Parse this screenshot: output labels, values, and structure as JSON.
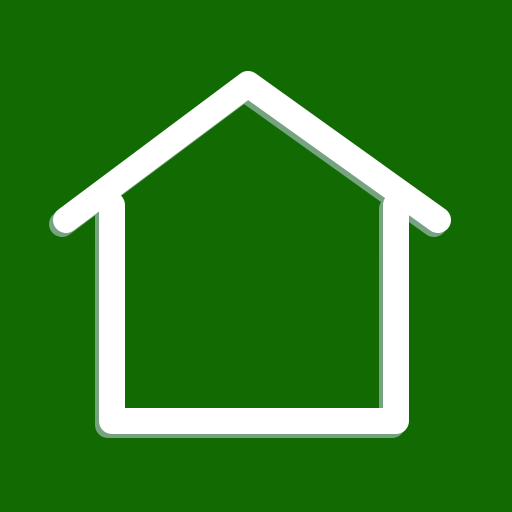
{
  "app_icon": {
    "icon": "home-icon",
    "colors": {
      "background": "#116A02",
      "stroke": "#FFFFFF",
      "shadow": "#C9D2E8"
    }
  }
}
